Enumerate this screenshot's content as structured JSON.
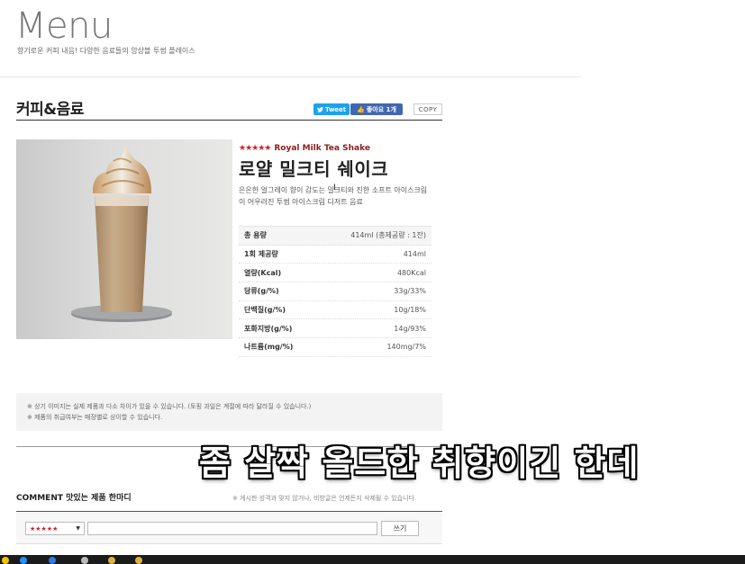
{
  "header": {
    "title": "Menu",
    "subtitle": "향기로운 커피 내음! 다양한 음료들의 앙상블 투썸 플레이스"
  },
  "category": {
    "title": "커피&음료",
    "tweet_label": "Tweet",
    "like_label": "좋아요 1개",
    "copy_label": "COPY"
  },
  "product": {
    "stars": "★★★★★",
    "name_en": "Royal Milk Tea Shake",
    "name_ko": "로얄 밀크티 쉐이크",
    "description": "은은한 얼그레이 향이 감도는 밀크티와 진한 소프트 아이스크림이 어우러진 투썸 아이스크림 디저트 음료",
    "nutrition": [
      {
        "label": "총 용량",
        "value": "414ml (총제공량 : 1잔)"
      },
      {
        "label": "1회 제공량",
        "value": "414ml"
      },
      {
        "label": "열량(Kcal)",
        "value": "480Kcal"
      },
      {
        "label": "당류(g/%)",
        "value": "33g/33%"
      },
      {
        "label": "단백질(g/%)",
        "value": "10g/18%"
      },
      {
        "label": "포화지방(g/%)",
        "value": "14g/93%"
      },
      {
        "label": "나트륨(mg/%)",
        "value": "140mg/7%"
      }
    ]
  },
  "notice": {
    "line1": "※ 상기 이미지는 실제 제품과 다소 차이가 있을 수 있습니다. (토핑 과일은 계절에 따라 달라질 수 있습니다.)",
    "line2": "※ 제품의 취급여부는 매장별로 상이할 수 있습니다."
  },
  "comments": {
    "title": "COMMENT 맛있는 제품 한마디",
    "note": "※ 게시판 성격과 맞지 않거나, 비방글은 언제든지 삭제될 수 있습니다.",
    "rating_value": "★★★★★",
    "input_placeholder": "",
    "write_label": "쓰기"
  },
  "overlay": {
    "subtitle": "좀 살짝 올드한 취향이긴 한데"
  },
  "colors": {
    "accent_red": "#c8252c",
    "twitter_blue": "#1da1f2",
    "facebook_blue": "#4267b2"
  }
}
